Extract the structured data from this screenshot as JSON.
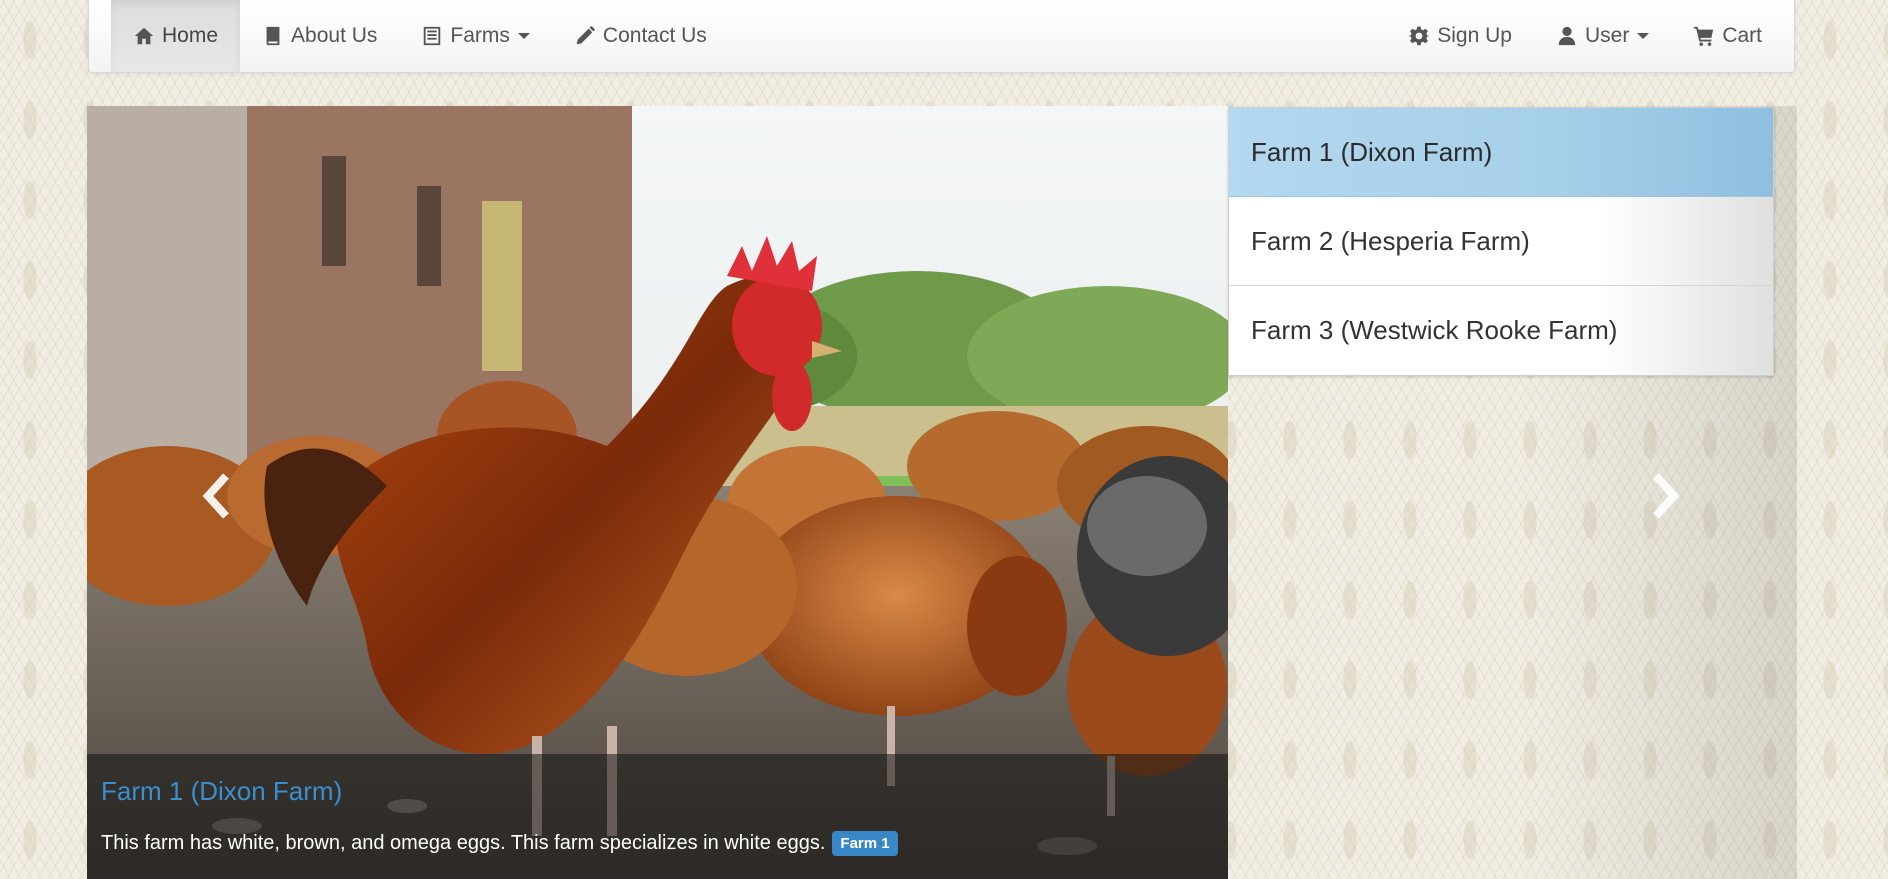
{
  "navbar": {
    "left": [
      {
        "label": "Home",
        "icon": "home-icon",
        "active": true
      },
      {
        "label": "About Us",
        "icon": "book-icon"
      },
      {
        "label": "Farms",
        "icon": "list-icon",
        "dropdown": true
      },
      {
        "label": "Contact Us",
        "icon": "pencil-icon"
      }
    ],
    "right": [
      {
        "label": "Sign Up",
        "icon": "gear-icon"
      },
      {
        "label": "User",
        "icon": "user-icon",
        "dropdown": true
      },
      {
        "label": "Cart",
        "icon": "cart-icon"
      }
    ]
  },
  "carousel": {
    "caption_title": "Farm 1 (Dixon Farm)",
    "caption_text": "This farm has white, brown, and omega eggs. This farm specializes in white eggs.",
    "badge": "Farm 1",
    "image": "chickens-photo"
  },
  "farm_list": [
    {
      "label": "Farm 1 (Dixon Farm)",
      "active": true
    },
    {
      "label": "Farm 2 (Hesperia Farm)"
    },
    {
      "label": "Farm 3 (Westwick Rooke Farm)"
    }
  ],
  "colors": {
    "accent": "#3a87c8",
    "active_list": "#a6cfe9",
    "caption_link": "#3a8fcf"
  }
}
